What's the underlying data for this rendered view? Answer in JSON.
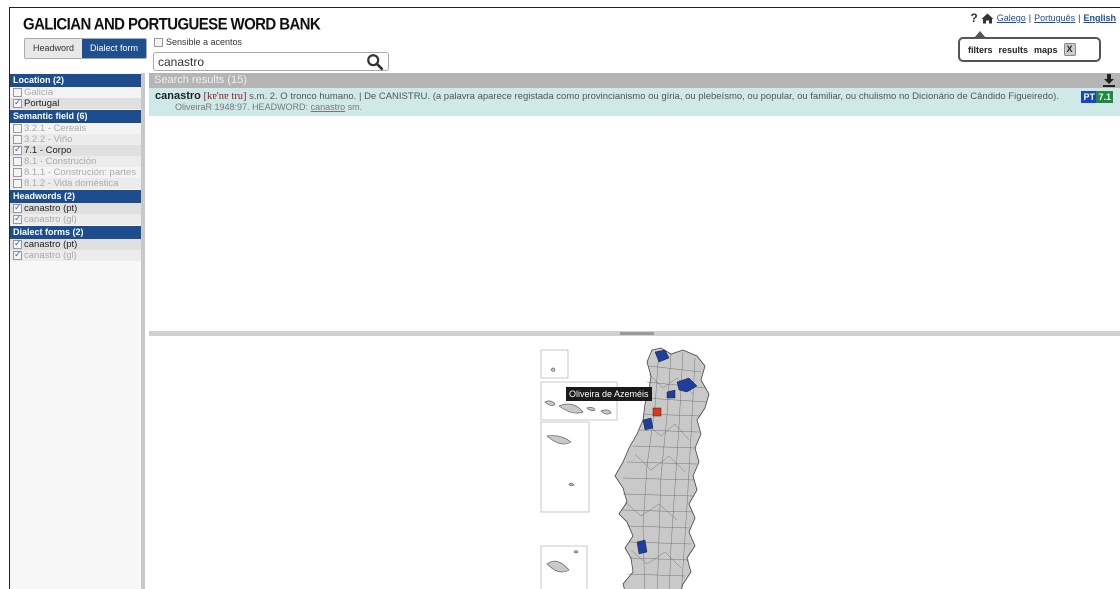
{
  "header": {
    "title": "GALICIAN AND PORTUGUESE WORD BANK",
    "toggle": [
      "Headword",
      "Dialect form"
    ],
    "accent_label": "Sensible a acentos",
    "search_value": "canastro",
    "help": "?",
    "languages": [
      "Galego",
      "Português",
      "English"
    ],
    "panel": {
      "filters": "filters",
      "results": "results",
      "maps": "maps",
      "close": "X"
    }
  },
  "sidebar": {
    "sections": [
      {
        "title": "Location (2)",
        "items": [
          {
            "label": "Galicia",
            "checked": false
          },
          {
            "label": "Portugal",
            "checked": true
          }
        ]
      },
      {
        "title": "Semantic field (6)",
        "items": [
          {
            "label": "3.2.1 - Cereais",
            "checked": false
          },
          {
            "label": "3.2.2 - Viño",
            "checked": false
          },
          {
            "label": "7.1 - Corpo",
            "checked": true
          },
          {
            "label": "8.1 - Construción",
            "checked": false
          },
          {
            "label": "8.1.1 - Construción: partes",
            "checked": false
          },
          {
            "label": "8.1.2 - Vida doméstica",
            "checked": false
          }
        ]
      },
      {
        "title": "Headwords (2)",
        "items": [
          {
            "label": "canastro (pt)",
            "checked": true
          },
          {
            "label": "canastro (gl)",
            "checked": true
          }
        ]
      },
      {
        "title": "Dialect forms (2)",
        "items": [
          {
            "label": "canastro (pt)",
            "checked": true
          },
          {
            "label": "canastro (gl)",
            "checked": true
          }
        ]
      }
    ]
  },
  "results": {
    "bar_label": "Search results (15)",
    "entry": {
      "headword": "canastro",
      "ipa": "[kɐ'nɐ tru]",
      "definition": "s.m. 2. O tronco humano. | De CANISTRU. (a palavra aparece registada como provincianismo ou gíria, ou plebeísmo, ou popular, ou familiar, ou chulismo no Dicionário de Cândido Figueiredo).",
      "source": "OliveiraR 1948:97.",
      "headword_label": "HEADWORD:",
      "headword_link": "canastro",
      "pos": "sm.",
      "tag_lang": "PT",
      "tag_field": "7.1"
    }
  },
  "map": {
    "tooltip": "Oliveira de Azeméis",
    "colors": {
      "fill": "#c9c9c9",
      "stroke": "#555555",
      "highlight": "#1e3f9e",
      "active": "#d93a1a"
    }
  }
}
